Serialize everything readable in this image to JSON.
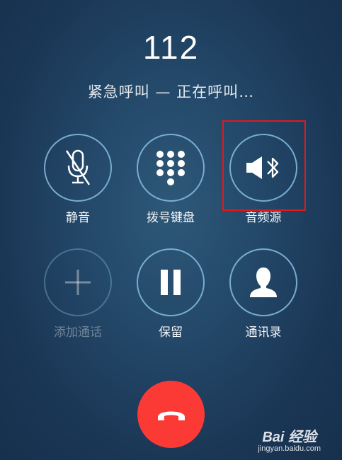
{
  "call": {
    "number": "112",
    "status": "紧急呼叫 — 正在呼叫…"
  },
  "controls": {
    "mute": {
      "label": "静音",
      "icon": "mic-off-icon"
    },
    "keypad": {
      "label": "拨号键盘",
      "icon": "dialpad-icon"
    },
    "audio_source": {
      "label": "音频源",
      "icon": "speaker-bluetooth-icon"
    },
    "add_call": {
      "label": "添加通话",
      "icon": "plus-icon",
      "enabled": false
    },
    "hold": {
      "label": "保留",
      "icon": "pause-icon"
    },
    "contacts": {
      "label": "通讯录",
      "icon": "person-icon"
    }
  },
  "end_call": {
    "icon": "hangup-phone-icon"
  },
  "watermark": {
    "logo": "Bai 经验",
    "url": "jingyan.baidu.com"
  },
  "colors": {
    "background": "#1f4060",
    "ring": "#87bee1",
    "end_call": "#fb3a36",
    "highlight": "#e0191c"
  }
}
